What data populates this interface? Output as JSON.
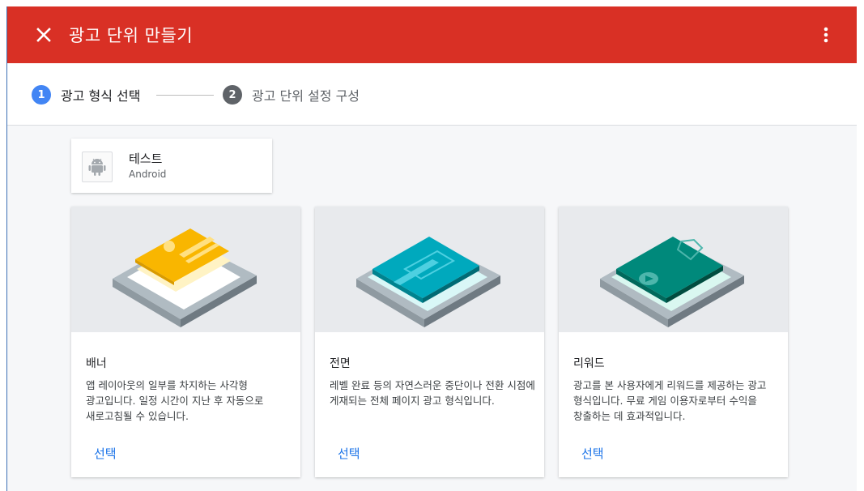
{
  "header": {
    "title": "광고 단위 만들기",
    "background": "#d93025"
  },
  "stepper": {
    "steps": [
      {
        "number": "1",
        "label": "광고 형식 선택",
        "active": true
      },
      {
        "number": "2",
        "label": "광고 단위 설정 구성",
        "active": false
      }
    ]
  },
  "app": {
    "name": "테스트",
    "platform": "Android",
    "icon": "android-icon"
  },
  "formats": [
    {
      "name": "배너",
      "description": "앱 레이아웃의 일부를 차지하는 사각형 광고입니다. 일정 시간이 지난 후 자동으로 새로고침될 수 있습니다.",
      "select_label": "선택",
      "accent": "#f9b600"
    },
    {
      "name": "전면",
      "description": "레벨 완료 등의 자연스러운 중단이나 전환 시점에 게재되는 전체 페이지 광고 형식입니다.",
      "select_label": "선택",
      "accent": "#00a9bd"
    },
    {
      "name": "리워드",
      "description": "광고를 본 사용자에게 리워드를 제공하는 광고 형식입니다. 무료 게임 이용자로부터 수익을 창출하는 데 효과적입니다.",
      "select_label": "선택",
      "accent": "#00897b"
    }
  ],
  "colors": {
    "primary": "#d93025",
    "link": "#1a73e8",
    "step_active": "#4285f4",
    "step_inactive": "#5f6368"
  }
}
